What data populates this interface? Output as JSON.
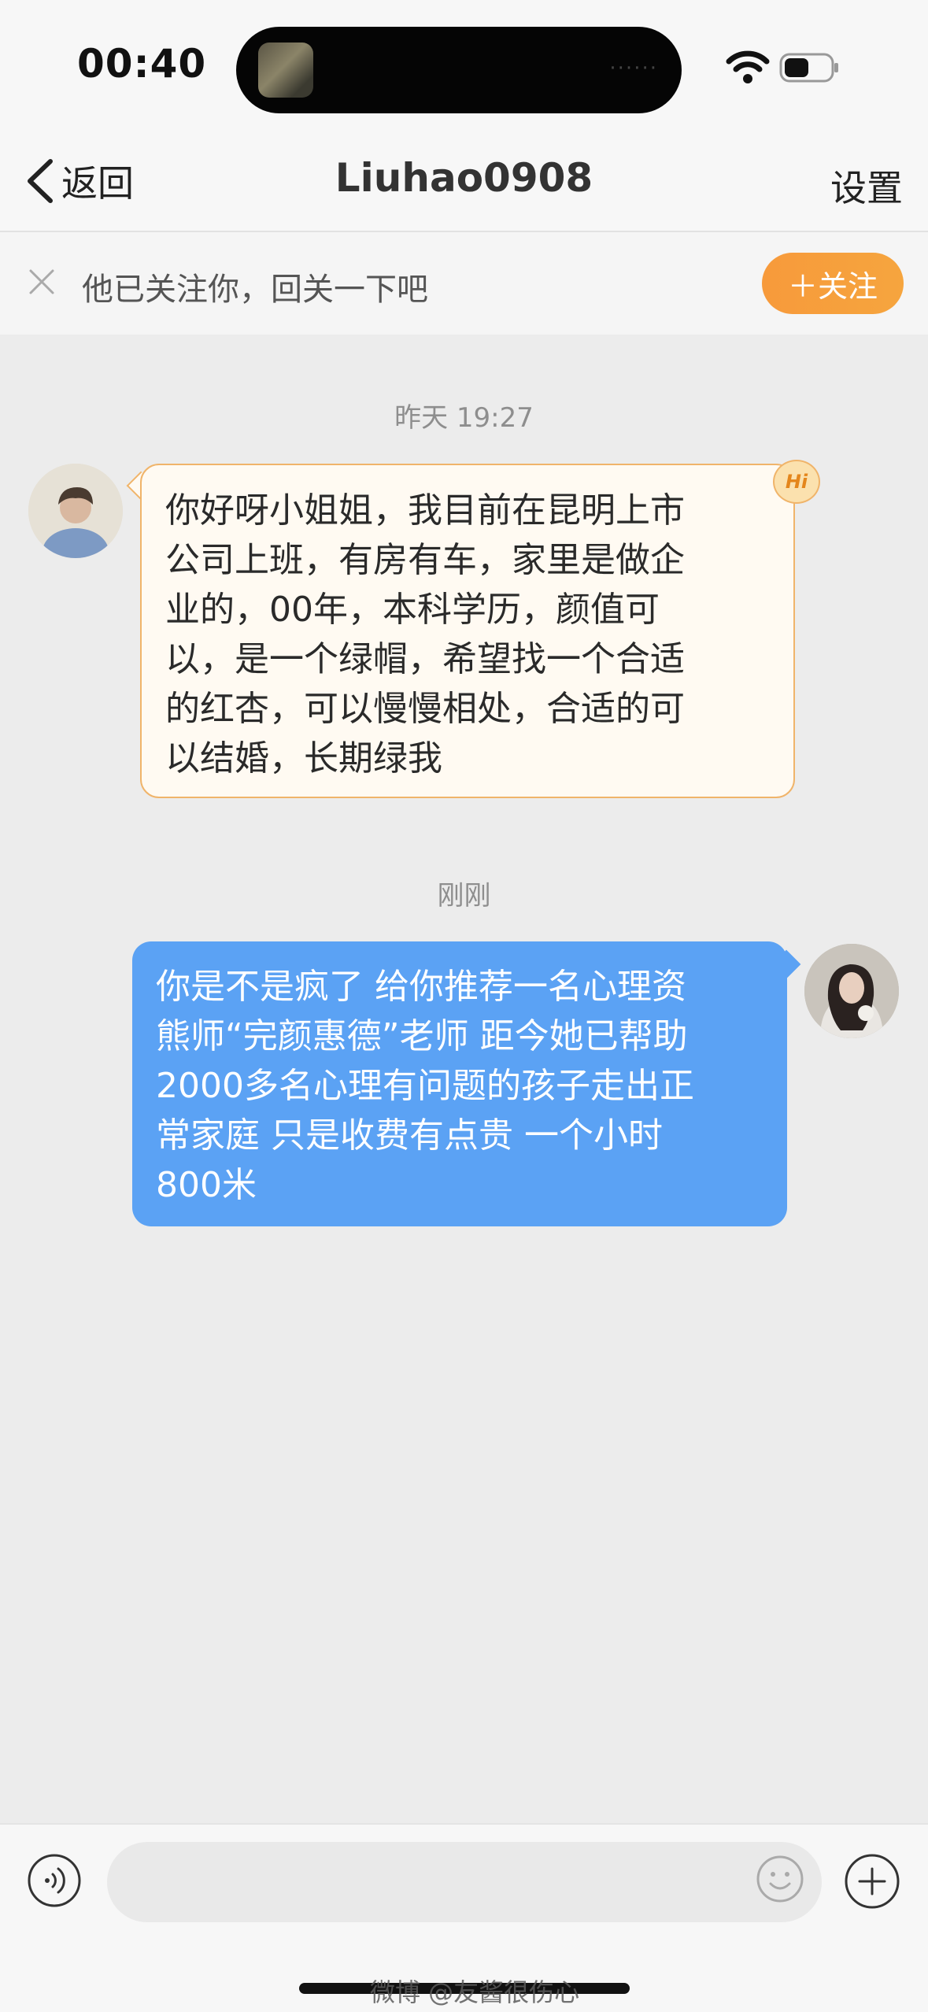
{
  "status_bar": {
    "time": "00:40"
  },
  "nav": {
    "back_label": "返回",
    "title": "Liuhao0908",
    "settings_label": "设置"
  },
  "follow_banner": {
    "text": "他已关注你，回关一下吧",
    "button_label": "＋关注"
  },
  "chat": {
    "messages": [
      {
        "timestamp": "昨天 19:27",
        "sender": "other",
        "badge": "Hi",
        "lines": [
          "你好呀小姐姐，我目前在昆明上市",
          "公司上班，有房有车，家里是做企",
          "业的，00年，本科学历，颜值可",
          "以，是一个绿帽，希望找一个合适",
          "的红杏，可以慢慢相处，合适的可",
          "以结婚，长期绿我"
        ]
      },
      {
        "timestamp": "刚刚",
        "sender": "me",
        "lines": [
          "你是不是疯了 给你推荐一名心理资",
          "熊师“完颜惠德”老师 距今她已帮助",
          "2000多名心理有问题的孩子走出正",
          "常家庭 只是收费有点贵 一个小时",
          "800米"
        ]
      }
    ]
  },
  "input": {
    "placeholder": "",
    "value": ""
  },
  "watermark": "微博 @友酱很伤心",
  "colors": {
    "accent_orange": "#f79a3b",
    "my_bubble": "#5ba2f4",
    "other_bubble": "#fffaf2",
    "other_bubble_border": "#f0b46a",
    "background": "#ececec"
  },
  "icons": [
    "wifi-icon",
    "battery-icon",
    "back-chevron-icon",
    "close-icon",
    "hi-badge-icon",
    "voice-icon",
    "emoji-icon",
    "plus-icon"
  ]
}
